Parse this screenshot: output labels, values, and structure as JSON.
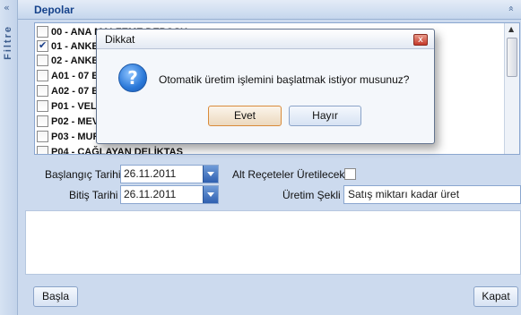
{
  "sidebar": {
    "filter_label": "Filtre",
    "collapse_glyph": "«"
  },
  "panel": {
    "title": "Depolar",
    "collapse_glyph": "»",
    "warehouses": [
      {
        "label": "00 - ANA MALZEME DEPOSU",
        "checked": false
      },
      {
        "label": "01 - ANKE",
        "checked": true
      },
      {
        "label": "02 - ANKE",
        "checked": false
      },
      {
        "label": "A01 - 07 E",
        "checked": false
      },
      {
        "label": "A02 - 07 E",
        "checked": false
      },
      {
        "label": "P01 - VELİ",
        "checked": false
      },
      {
        "label": "P02 - MEVL",
        "checked": false
      },
      {
        "label": "P03 - MUR",
        "checked": false
      },
      {
        "label": "P04 - ÇAĞLAYAN DELİKTAŞ",
        "checked": false
      }
    ]
  },
  "form": {
    "start_date_label": "Başlangıç Tarihi",
    "start_date_value": "26.11.2011",
    "end_date_label": "Bitiş Tarihi",
    "end_date_value": "26.11.2011",
    "sub_recipes_label": "Alt Reçeteler Üretilecek",
    "sub_recipes_checked": false,
    "production_type_label": "Üretim Şekli",
    "production_type_value": "Satış miktarı kadar üret"
  },
  "buttons": {
    "start": "Başla",
    "close": "Kapat"
  },
  "dialog": {
    "title": "Dikkat",
    "close_glyph": "x",
    "icon_glyph": "?",
    "message": "Otomatik üretim işlemini başlatmak istiyor musunuz?",
    "yes_label": "Evet",
    "no_label": "Hayır"
  }
}
